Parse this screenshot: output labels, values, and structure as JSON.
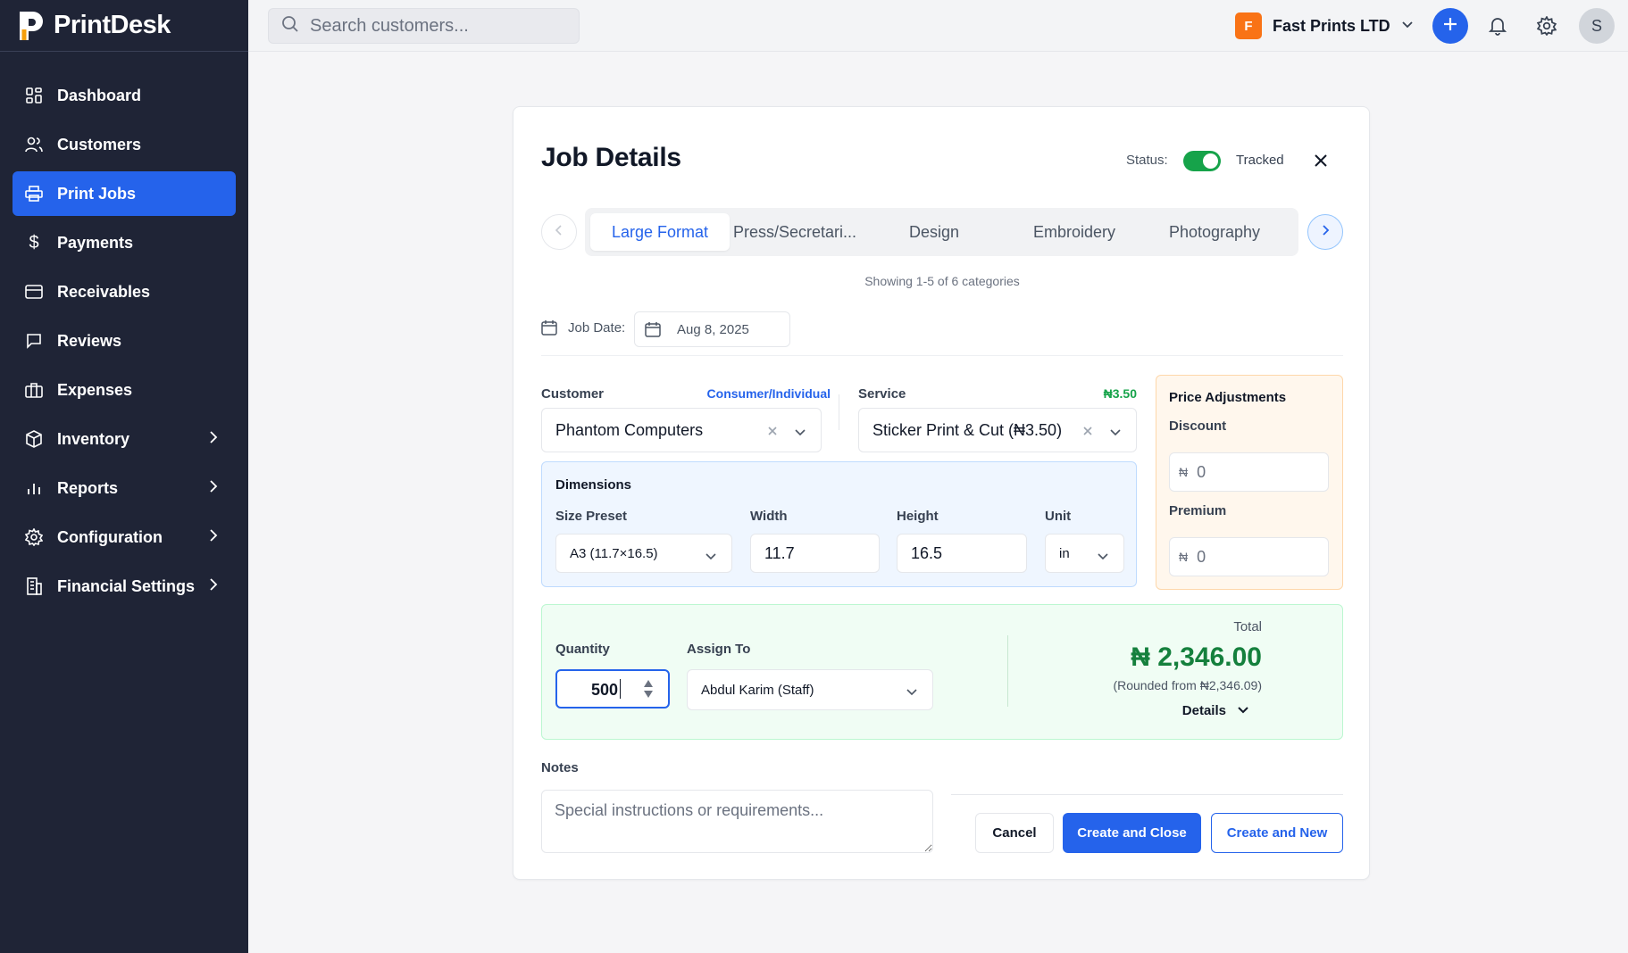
{
  "app": {
    "name": "PrintDesk"
  },
  "sidebar": {
    "items": [
      {
        "label": "Dashboard",
        "icon": "dashboard-icon"
      },
      {
        "label": "Customers",
        "icon": "users-icon"
      },
      {
        "label": "Print Jobs",
        "icon": "printer-icon",
        "active": true
      },
      {
        "label": "Payments",
        "icon": "dollar-icon"
      },
      {
        "label": "Receivables",
        "icon": "card-icon"
      },
      {
        "label": "Reviews",
        "icon": "chat-icon"
      },
      {
        "label": "Expenses",
        "icon": "briefcase-icon"
      },
      {
        "label": "Inventory",
        "icon": "box-icon",
        "expandable": true
      },
      {
        "label": "Reports",
        "icon": "bar-chart-icon",
        "expandable": true
      },
      {
        "label": "Configuration",
        "icon": "gear-icon",
        "expandable": true
      },
      {
        "label": "Financial Settings",
        "icon": "building-icon",
        "expandable": true
      }
    ]
  },
  "topbar": {
    "search_placeholder": "Search customers...",
    "company_initial": "F",
    "company_name": "Fast Prints LTD",
    "avatar_initial": "S"
  },
  "job": {
    "title": "Job Details",
    "status_label": "Status:",
    "status_value": "Tracked",
    "tabs": [
      "Large Format",
      "Press/Secretari...",
      "Design",
      "Embroidery",
      "Photography"
    ],
    "showing": "Showing 1-5 of 6 categories",
    "job_date_label": "Job Date:",
    "job_date": "Aug 8, 2025",
    "customer_label": "Customer",
    "customer_type": "Consumer/Individual",
    "customer_value": "Phantom Computers",
    "service_label": "Service",
    "service_price": "₦3.50",
    "service_value": "Sticker Print & Cut (₦3.50)",
    "dimensions": {
      "title": "Dimensions",
      "size_preset_label": "Size Preset",
      "size_preset": "A3 (11.7×16.5)",
      "width_label": "Width",
      "width": "11.7",
      "height_label": "Height",
      "height": "16.5",
      "unit_label": "Unit",
      "unit": "in"
    },
    "price_adjustments": {
      "title": "Price Adjustments",
      "discount_label": "Discount",
      "discount": "0",
      "premium_label": "Premium",
      "premium": "0",
      "currency": "₦"
    },
    "quantity_label": "Quantity",
    "quantity": "500",
    "assign_label": "Assign To",
    "assign_value": "Abdul Karim (Staff)",
    "total_label": "Total",
    "total_value": "₦ 2,346.00",
    "rounded_note": "(Rounded from ₦2,346.09)",
    "details_label": "Details",
    "notes_label": "Notes",
    "notes_placeholder": "Special instructions or requirements...",
    "cancel_label": "Cancel",
    "create_close_label": "Create and Close",
    "create_new_label": "Create and New"
  },
  "colors": {
    "sidebar_bg": "#1f2436",
    "accent": "#2563eb",
    "success": "#16a34a",
    "brand_orange": "#f97316"
  }
}
